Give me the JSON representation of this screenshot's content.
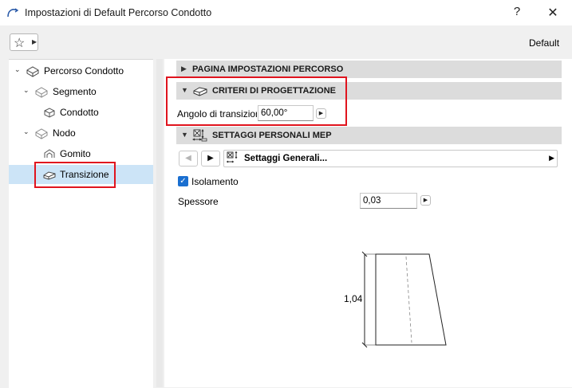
{
  "window": {
    "title": "Impostazioni di Default Percorso Condotto",
    "help": "?",
    "close": "✕"
  },
  "toolbar": {
    "favorites_icon": "star-icon",
    "profile_label": "Default"
  },
  "tree": {
    "items": [
      {
        "label": "Percorso Condotto",
        "icon": "route-icon"
      },
      {
        "label": "Segmento",
        "icon": "segment-icon"
      },
      {
        "label": "Condotto",
        "icon": "duct-icon"
      },
      {
        "label": "Nodo",
        "icon": "node-icon"
      },
      {
        "label": "Gomito",
        "icon": "elbow-icon"
      },
      {
        "label": "Transizione",
        "icon": "transition-icon",
        "selected": true
      }
    ]
  },
  "panel": {
    "section_page": "PAGINA IMPOSTAZIONI PERCORSO",
    "section_design": "CRITERI DI PROGETTAZIONE",
    "transition_angle_label": "Angolo di transizione",
    "transition_angle_value": "60,00°",
    "section_mep": "SETTAGGI PERSONALI MEP",
    "preset_name": "Settaggi Generali...",
    "insulation_label": "Isolamento",
    "insulation_checked": true,
    "thickness_label": "Spessore",
    "thickness_value": "0,03",
    "preview_dimension": "1,04"
  },
  "colors": {
    "highlight_box": "#e0141e",
    "selection": "#cce4f7",
    "checkbox": "#1a6fd0"
  }
}
